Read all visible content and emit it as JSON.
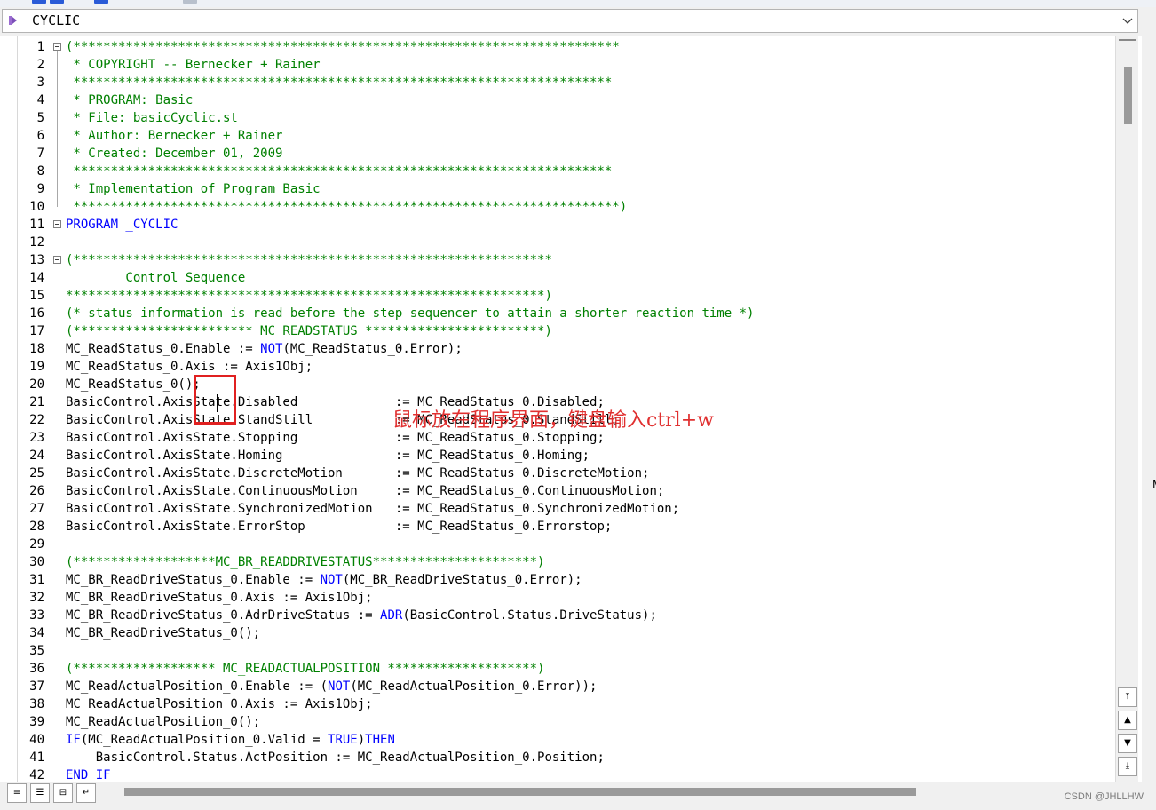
{
  "combo": {
    "value": "_CYCLIC"
  },
  "lines": [
    {
      "n": "1",
      "fold": "start",
      "segs": [
        {
          "t": "(*************************************************************************",
          "c": "cmt"
        }
      ]
    },
    {
      "n": "2",
      "segs": [
        {
          "t": " * COPYRIGHT -- Bernecker + Rainer",
          "c": "cmt"
        }
      ]
    },
    {
      "n": "3",
      "segs": [
        {
          "t": " ************************************************************************",
          "c": "cmt"
        }
      ]
    },
    {
      "n": "4",
      "segs": [
        {
          "t": " * PROGRAM: Basic",
          "c": "cmt"
        }
      ]
    },
    {
      "n": "5",
      "segs": [
        {
          "t": " * File: basicCyclic.st",
          "c": "cmt"
        }
      ]
    },
    {
      "n": "6",
      "segs": [
        {
          "t": " * Author: Bernecker + Rainer",
          "c": "cmt"
        }
      ]
    },
    {
      "n": "7",
      "segs": [
        {
          "t": " * Created: December 01, 2009",
          "c": "cmt"
        }
      ]
    },
    {
      "n": "8",
      "segs": [
        {
          "t": " ************************************************************************",
          "c": "cmt"
        }
      ]
    },
    {
      "n": "9",
      "segs": [
        {
          "t": " * Implementation of Program Basic",
          "c": "cmt"
        }
      ]
    },
    {
      "n": "10",
      "fold": "end",
      "segs": [
        {
          "t": " *************************************************************************)",
          "c": "cmt"
        }
      ]
    },
    {
      "n": "11",
      "fold": "start",
      "segs": [
        {
          "t": "PROGRAM _CYCLIC",
          "c": "kw"
        }
      ]
    },
    {
      "n": "12",
      "segs": []
    },
    {
      "n": "13",
      "fold": "start",
      "segs": [
        {
          "t": "(****************************************************************",
          "c": "cmt"
        }
      ]
    },
    {
      "n": "14",
      "segs": [
        {
          "t": "        Control Sequence",
          "c": "cmt"
        }
      ]
    },
    {
      "n": "15",
      "segs": [
        {
          "t": "****************************************************************)",
          "c": "cmt"
        }
      ]
    },
    {
      "n": "16",
      "segs": [
        {
          "t": "(* status information is read before the step sequencer to attain a shorter reaction time *)",
          "c": "cmt"
        }
      ]
    },
    {
      "n": "17",
      "segs": [
        {
          "t": "(************************ MC_READSTATUS ************************)",
          "c": "cmt"
        }
      ]
    },
    {
      "n": "18",
      "segs": [
        {
          "t": "MC_ReadStatus_0.Enable := "
        },
        {
          "t": "NOT",
          "c": "kw"
        },
        {
          "t": "(MC_ReadStatus_0.Error);"
        }
      ]
    },
    {
      "n": "19",
      "segs": [
        {
          "t": "MC_ReadStatus_0.Axis := Axis1Obj;"
        }
      ]
    },
    {
      "n": "20",
      "segs": [
        {
          "t": "MC_ReadStatus_0();"
        }
      ]
    },
    {
      "n": "21",
      "segs": [
        {
          "t": "BasicControl.AxisState.Disabled             := MC_ReadStatus_0.Disabled;"
        }
      ]
    },
    {
      "n": "22",
      "segs": [
        {
          "t": "BasicControl.AxisState.StandStill           := MC_ReadStatus_0.StandStill;"
        }
      ]
    },
    {
      "n": "23",
      "segs": [
        {
          "t": "BasicControl.AxisState.Stopping             := MC_ReadStatus_0.Stopping;"
        }
      ]
    },
    {
      "n": "24",
      "segs": [
        {
          "t": "BasicControl.AxisState.Homing               := MC_ReadStatus_0.Homing;"
        }
      ]
    },
    {
      "n": "25",
      "segs": [
        {
          "t": "BasicControl.AxisState.DiscreteMotion       := MC_ReadStatus_0.DiscreteMotion;"
        }
      ]
    },
    {
      "n": "26",
      "segs": [
        {
          "t": "BasicControl.AxisState.ContinuousMotion     := MC_ReadStatus_0.ContinuousMotion;"
        }
      ]
    },
    {
      "n": "27",
      "segs": [
        {
          "t": "BasicControl.AxisState.SynchronizedMotion   := MC_ReadStatus_0.SynchronizedMotion;"
        }
      ]
    },
    {
      "n": "28",
      "segs": [
        {
          "t": "BasicControl.AxisState.ErrorStop            := MC_ReadStatus_0.Errorstop;"
        }
      ]
    },
    {
      "n": "29",
      "segs": []
    },
    {
      "n": "30",
      "segs": [
        {
          "t": "(*******************MC_BR_READDRIVESTATUS**********************)",
          "c": "cmt"
        }
      ]
    },
    {
      "n": "31",
      "segs": [
        {
          "t": "MC_BR_ReadDriveStatus_0.Enable := "
        },
        {
          "t": "NOT",
          "c": "kw"
        },
        {
          "t": "(MC_BR_ReadDriveStatus_0.Error);"
        }
      ]
    },
    {
      "n": "32",
      "segs": [
        {
          "t": "MC_BR_ReadDriveStatus_0.Axis := Axis1Obj;"
        }
      ]
    },
    {
      "n": "33",
      "segs": [
        {
          "t": "MC_BR_ReadDriveStatus_0.AdrDriveStatus := "
        },
        {
          "t": "ADR",
          "c": "kw"
        },
        {
          "t": "(BasicControl.Status.DriveStatus);"
        }
      ]
    },
    {
      "n": "34",
      "segs": [
        {
          "t": "MC_BR_ReadDriveStatus_0();"
        }
      ]
    },
    {
      "n": "35",
      "segs": []
    },
    {
      "n": "36",
      "segs": [
        {
          "t": "(******************* MC_READACTUALPOSITION ********************)",
          "c": "cmt"
        }
      ]
    },
    {
      "n": "37",
      "segs": [
        {
          "t": "MC_ReadActualPosition_0.Enable := ("
        },
        {
          "t": "NOT",
          "c": "kw"
        },
        {
          "t": "(MC_ReadActualPosition_0.Error));"
        }
      ]
    },
    {
      "n": "38",
      "segs": [
        {
          "t": "MC_ReadActualPosition_0.Axis := Axis1Obj;"
        }
      ]
    },
    {
      "n": "39",
      "segs": [
        {
          "t": "MC_ReadActualPosition_0();"
        }
      ]
    },
    {
      "n": "40",
      "segs": [
        {
          "t": "IF",
          "c": "kw"
        },
        {
          "t": "(MC_ReadActualPosition_0.Valid = "
        },
        {
          "t": "TRUE",
          "c": "kw"
        },
        {
          "t": ")"
        },
        {
          "t": "THEN",
          "c": "kw"
        }
      ]
    },
    {
      "n": "41",
      "segs": [
        {
          "t": "    BasicControl.Status.ActPosition := MC_ReadActualPosition_0.Position;"
        }
      ]
    },
    {
      "n": "42",
      "segs": [
        {
          "t": "END_IF",
          "c": "kw"
        }
      ]
    }
  ],
  "annotation": {
    "text": "鼠标放在程序界面，键盘输入ctrl+w"
  },
  "watermark": "CSDN @JHLLHW",
  "right_marker": "M",
  "colors": {
    "comment": "#008000",
    "keyword": "#0000ff",
    "annotation": "#e03030"
  },
  "icons": {
    "combo": "program-icon",
    "dropdown": "chevron-down-icon"
  }
}
